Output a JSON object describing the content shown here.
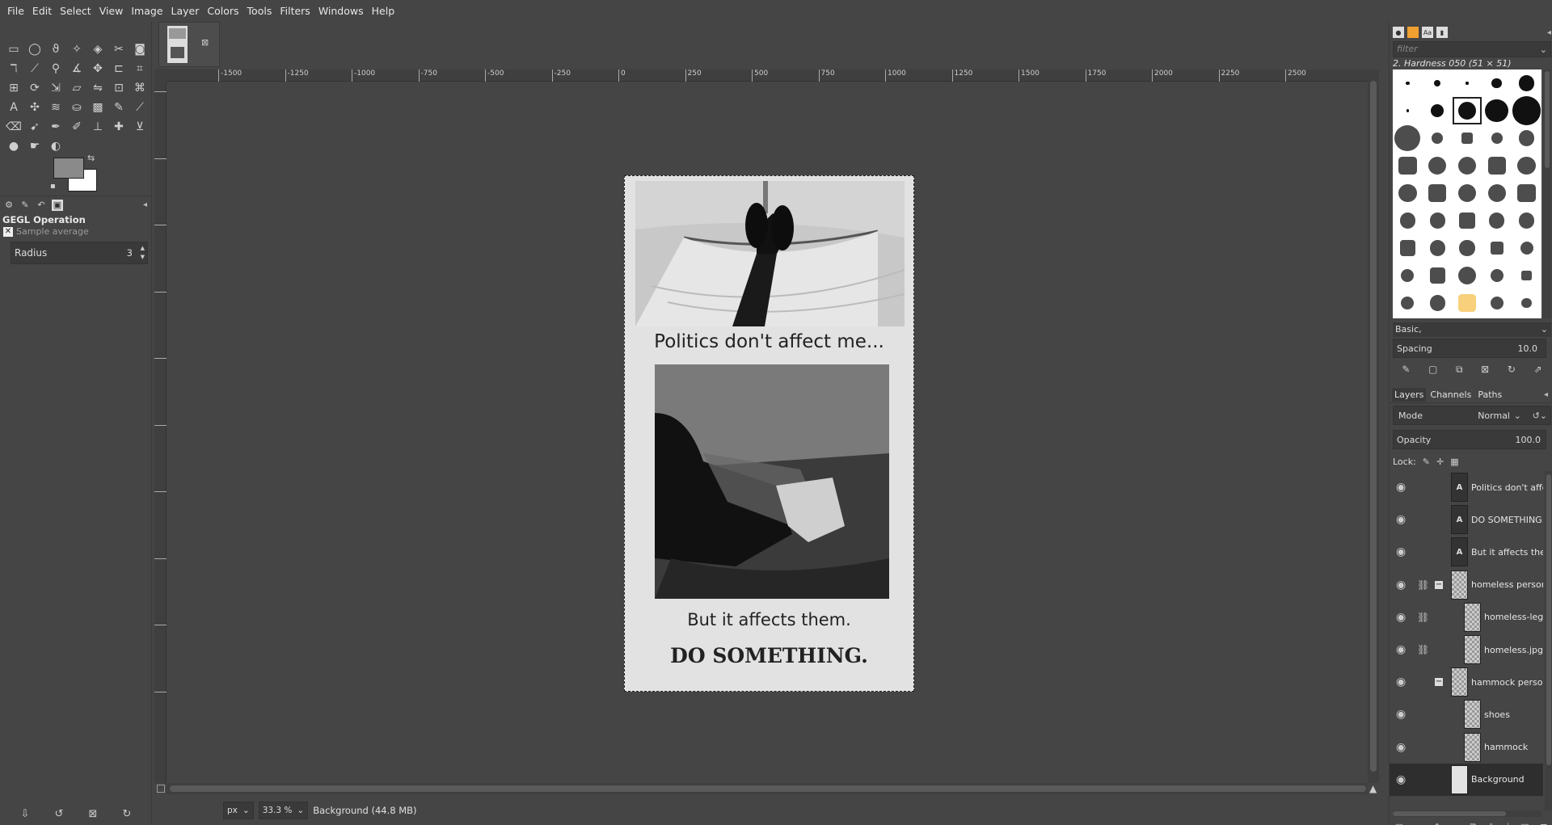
{
  "menubar": {
    "items": [
      "File",
      "Edit",
      "Select",
      "View",
      "Image",
      "Layer",
      "Colors",
      "Tools",
      "Filters",
      "Windows",
      "Help"
    ]
  },
  "toolbox": {
    "tools": [
      "rect-select-icon",
      "ellipse-select-icon",
      "free-select-icon",
      "fuzzy-select-icon",
      "select-by-color-icon",
      "scissors-icon",
      "foreground-select-icon",
      "paths-icon",
      "color-picker-icon",
      "zoom-icon",
      "measure-icon",
      "move-icon",
      "align-icon",
      "crop-icon",
      "unified-transform-icon",
      "rotate-icon",
      "scale-icon",
      "shear-icon",
      "flip-icon",
      "perspective-icon",
      "cage-icon",
      "text-icon",
      "handle-transform-icon",
      "warp-icon",
      "bucket-fill-icon",
      "gradient-icon",
      "pencil-icon",
      "paintbrush-icon",
      "eraser-icon",
      "airbrush-icon",
      "ink-icon",
      "mypaint-icon",
      "clone-icon",
      "heal-icon",
      "perspective-clone-icon",
      "blur-icon",
      "smudge-icon",
      "dodge-burn-icon"
    ],
    "fg_color": "#8a8a8a",
    "bg_color": "#ffffff",
    "tool_options_title": "GEGL Operation",
    "sample_label": "Sample average",
    "radius_label": "Radius",
    "radius_value": "3"
  },
  "canvas": {
    "ruler_ticks": [
      "-1500",
      "-1250",
      "-1000",
      "-750",
      "-500",
      "-250",
      "0",
      "250",
      "500",
      "750",
      "1000",
      "1250",
      "1500",
      "1750",
      "2000",
      "2250",
      "2500"
    ],
    "caption1": "Politics don't affect me...",
    "caption2": "But it affects them.",
    "caption3": "DO SOMETHING."
  },
  "statusbar": {
    "unit": "px",
    "zoom": "33.3 %",
    "info": "Background (44.8 MB)"
  },
  "brushes": {
    "filter_placeholder": "filter",
    "selected_name": "2. Hardness 050 (51 × 51)",
    "preset": "Basic,",
    "spacing_label": "Spacing",
    "spacing_value": "10.0"
  },
  "layers_panel": {
    "tabs": [
      "Layers",
      "Channels",
      "Paths"
    ],
    "mode_label": "Mode",
    "mode_value": "Normal",
    "opacity_label": "Opacity",
    "opacity_value": "100.0",
    "lock_label": "Lock:",
    "layers": [
      {
        "name": "Politics don't affe",
        "type": "text",
        "indent": 0,
        "chain": false,
        "expander": false
      },
      {
        "name": "DO SOMETHING.",
        "type": "text",
        "indent": 0,
        "chain": false,
        "expander": false
      },
      {
        "name": "But it affects the",
        "type": "text",
        "indent": 0,
        "chain": false,
        "expander": false
      },
      {
        "name": "homeless person",
        "type": "group",
        "indent": 0,
        "chain": true,
        "expander": true
      },
      {
        "name": "homeless-leg",
        "type": "image",
        "indent": 1,
        "chain": true,
        "expander": false
      },
      {
        "name": "homeless.jpg",
        "type": "image",
        "indent": 1,
        "chain": true,
        "expander": false
      },
      {
        "name": "hammock person",
        "type": "group",
        "indent": 0,
        "chain": false,
        "expander": true
      },
      {
        "name": "shoes",
        "type": "image",
        "indent": 1,
        "chain": false,
        "expander": false
      },
      {
        "name": "hammock",
        "type": "image",
        "indent": 1,
        "chain": false,
        "expander": false
      },
      {
        "name": "Background",
        "type": "background",
        "indent": 0,
        "chain": false,
        "expander": false
      }
    ]
  }
}
